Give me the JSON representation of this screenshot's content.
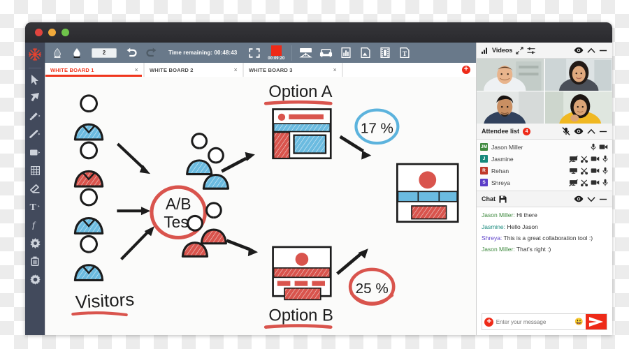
{
  "window": {
    "traffic_lights": [
      "close",
      "minimize",
      "maximize"
    ]
  },
  "tool_rail": {
    "logo": "snowflake-logo",
    "tools": [
      {
        "name": "select-cursor-tool",
        "icon": "cursor-arrow-icon"
      },
      {
        "name": "pan-tool",
        "icon": "arrow-up-left-icon"
      },
      {
        "name": "pen-tool",
        "icon": "pen-icon"
      },
      {
        "name": "line-tool",
        "icon": "line-icon"
      },
      {
        "name": "shape-tool",
        "icon": "rectangle-icon"
      },
      {
        "name": "grid-tool",
        "icon": "grid-icon"
      },
      {
        "name": "eraser-tool",
        "icon": "eraser-icon"
      },
      {
        "name": "text-tool",
        "icon": "text-T-icon"
      },
      {
        "name": "formula-tool",
        "icon": "function-f-icon"
      },
      {
        "name": "effects-tool",
        "icon": "starburst-icon"
      },
      {
        "name": "delete-tool",
        "icon": "trash-icon"
      },
      {
        "name": "settings-tool",
        "icon": "gear-icon"
      }
    ]
  },
  "toolbar": {
    "fill_color_label": "fill-dropper-icon",
    "stroke_color_label": "stroke-dropper-icon",
    "pen_size": "2",
    "undo_label": "undo-icon",
    "redo_label": "redo-icon",
    "time_remaining": "Time remaining: 00:48:43",
    "fullscreen_label": "fullscreen-icon",
    "recording_time": "00:09:20",
    "recording_color": "#ee2a18",
    "media_buttons": [
      {
        "name": "whiteboard-button",
        "icon": "whiteboard-easel-icon"
      },
      {
        "name": "furniture-button",
        "icon": "sofa-icon"
      },
      {
        "name": "chart-button",
        "icon": "bar-chart-icon"
      },
      {
        "name": "image-button",
        "icon": "image-icon"
      },
      {
        "name": "video-button",
        "icon": "film-strip-icon"
      },
      {
        "name": "document-button",
        "icon": "text-document-icon"
      }
    ]
  },
  "tabs": {
    "items": [
      {
        "label": "WHITE BOARD 1",
        "active": true
      },
      {
        "label": "WHITE BOARD 2",
        "active": false
      },
      {
        "label": "WHITE BOARD 3",
        "active": false
      }
    ],
    "close_glyph": "×",
    "add_label": "+",
    "active_color": "#f0361d"
  },
  "whiteboard": {
    "labels": {
      "visitors": "Visitors",
      "ab_test_line1": "A/B",
      "ab_test_line2": "Test",
      "option_a": "Option A",
      "option_b": "Option B",
      "pct_a": "17 %",
      "pct_b": "25 %"
    },
    "colors": {
      "ink": "#1a1a1a",
      "red": "#d94a4a",
      "blue": "#5cb3dd"
    }
  },
  "videos_panel": {
    "title": "Videos",
    "signal_icon": "signal-bars-icon",
    "expand_icon": "expand-arrows-icon",
    "settings_icon": "sliders-icon",
    "eye_icon": "eye-icon",
    "collapse_icon": "chevron-up-icon",
    "minimize_icon": "minus-icon",
    "tiles": [
      {
        "name": "video-tile-jason",
        "skin": "#e8b48c",
        "hair": "#5b3b23",
        "shirt": "#e9edf1",
        "bg": "#cfd6d2"
      },
      {
        "name": "video-tile-jasmine",
        "skin": "#e0a97e",
        "hair": "#221a16",
        "shirt": "#4a4f58",
        "bg": "#dde3e4"
      },
      {
        "name": "video-tile-rehan",
        "skin": "#c98f62",
        "hair": "#17120f",
        "shirt": "#31415c",
        "bg": "#e4e7e6"
      },
      {
        "name": "video-tile-shreya",
        "skin": "#dba477",
        "hair": "#1c1512",
        "shirt": "#f0b822",
        "bg": "#dfe6df"
      }
    ]
  },
  "attendee_panel": {
    "title": "Attendee list",
    "count": "4",
    "mute_all_icon": "mic-muted-icon",
    "eye_icon": "eye-icon",
    "collapse_icon": "chevron-up-icon",
    "minimize_icon": "minus-icon",
    "attendees": [
      {
        "initials": "JM",
        "name": "Jason Miller",
        "color": "#3f8a3f",
        "icons": [
          "mic-icon",
          "camera-icon"
        ]
      },
      {
        "initials": "J",
        "name": "Jasmine",
        "color": "#17897c",
        "icons": [
          "screen-share-off-icon",
          "scissors-icon",
          "camera-icon",
          "mic-icon"
        ]
      },
      {
        "initials": "R",
        "name": "Rehan",
        "color": "#c0392b",
        "icons": [
          "screen-share-icon",
          "scissors-icon",
          "camera-icon",
          "mic-icon"
        ]
      },
      {
        "initials": "S",
        "name": "Shreya",
        "color": "#5b3ec8",
        "icons": [
          "screen-share-off-icon",
          "scissors-icon",
          "camera-icon",
          "mic-icon"
        ]
      }
    ]
  },
  "chat_panel": {
    "title": "Chat",
    "save_icon": "floppy-save-icon",
    "eye_icon": "eye-icon",
    "collapse_icon": "chevron-down-icon",
    "minimize_icon": "minus-icon",
    "messages": [
      {
        "who": "Jason Miller:",
        "text": " Hi there",
        "color": "#3f8a3f"
      },
      {
        "who": "Jasmine:",
        "text": " Hello Jason",
        "color": "#17897c"
      },
      {
        "who": "Shreya:",
        "text": " This is a great collaboration tool :)",
        "color": "#5b3ec8"
      },
      {
        "who": "Jason Miller:",
        "text": " That’s right :)",
        "color": "#3f8a3f"
      }
    ],
    "input_placeholder": "Enter your message",
    "plus_label": "+",
    "emoji": "😃",
    "send_icon": "send-paper-plane-icon",
    "send_color": "#ee2a18"
  }
}
